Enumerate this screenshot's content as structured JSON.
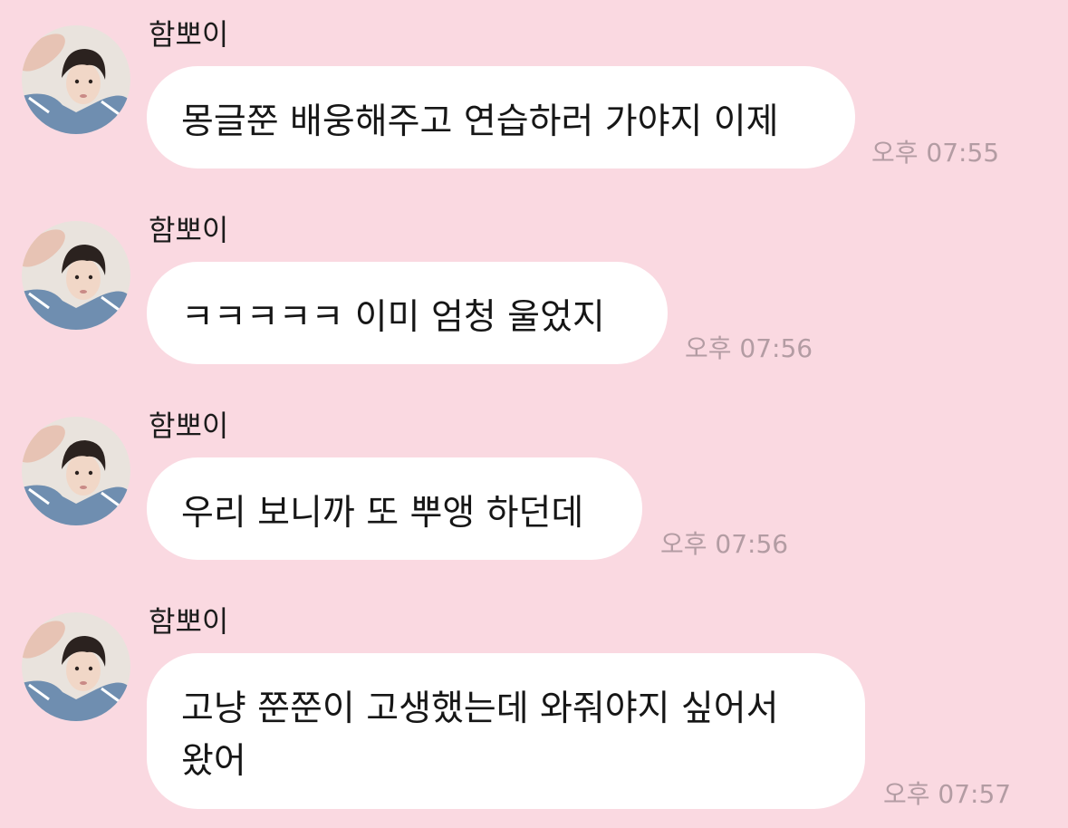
{
  "chat": {
    "messages": [
      {
        "sender": "함뽀이",
        "lines": [
          "몽글쭌 배웅해주고 연습하러 가야지 이제"
        ],
        "time": "오후 07:55"
      },
      {
        "sender": "함뽀이",
        "lines": [
          "ㅋㅋㅋㅋㅋ 이미 엄청 울었지"
        ],
        "time": "오후 07:56"
      },
      {
        "sender": "함뽀이",
        "lines": [
          "우리 보니까 또 뿌앵 하던데"
        ],
        "time": "오후 07:56"
      },
      {
        "sender": "함뽀이",
        "lines": [
          "고냥 쭌쭌이 고생했는데 와줘야지 싶어서",
          "왔어"
        ],
        "time": "오후 07:57"
      }
    ]
  }
}
